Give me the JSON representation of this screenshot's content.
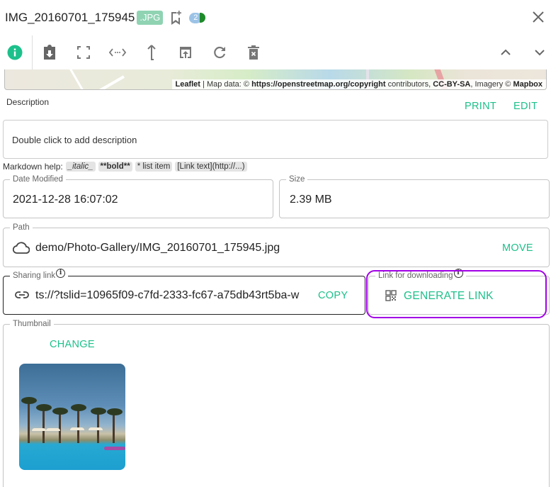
{
  "header": {
    "file_name": "IMG_20160701_175945",
    "extension": ".JPG",
    "badge_count": "2",
    "colors": {
      "extension_badge": "#8fd3b3",
      "count_badge": "#9cc3e6",
      "accent": "#1dc08b",
      "highlight": "#a100e6"
    }
  },
  "toolbar": {
    "buttons": [
      {
        "name": "info",
        "icon": "info-icon"
      },
      {
        "name": "download",
        "icon": "clipboard-download-icon"
      },
      {
        "name": "fullscreen",
        "icon": "fullscreen-icon"
      },
      {
        "name": "open-native",
        "icon": "code-arrows-icon"
      },
      {
        "name": "open-parent",
        "icon": "arrow-up-icon"
      },
      {
        "name": "open-in-new-window",
        "icon": "open-in-new-icon"
      },
      {
        "name": "reload",
        "icon": "refresh-icon"
      },
      {
        "name": "delete",
        "icon": "delete-icon"
      },
      {
        "name": "previous",
        "icon": "chevron-up-icon"
      },
      {
        "name": "next",
        "icon": "chevron-down-icon"
      }
    ]
  },
  "map": {
    "attribution": {
      "leaflet": "Leaflet",
      "sep": " | Map data: © ",
      "osm_link": "https://openstreetmap.org/copyright",
      "contributors": " contributors, ",
      "license": "CC-BY-SA",
      "imagery": ", Imagery © ",
      "provider": "Mapbox"
    }
  },
  "description": {
    "label": "Description",
    "print_label": "PRINT",
    "edit_label": "EDIT",
    "placeholder": "Double click to add description"
  },
  "markdown_help": {
    "label": "Markdown help:",
    "chips": [
      "_italic_",
      "**bold**",
      "* list item",
      "[Link text](http://...)"
    ]
  },
  "properties": {
    "date_modified": {
      "label": "Date Modified",
      "value": "2021-12-28 16:07:02"
    },
    "size": {
      "label": "Size",
      "value": "2.39 MB"
    },
    "path": {
      "label": "Path",
      "value": "demo/Photo-Gallery/IMG_20160701_175945.jpg",
      "action": "MOVE"
    },
    "sharing_link": {
      "label": "Sharing link",
      "value": "ts://?tslid=10965f09-c7fd-2333-fc67-a75db43rt5ba-w",
      "action": "COPY"
    },
    "download_link": {
      "label": "Link for downloading",
      "action": "GENERATE LINK"
    },
    "thumbnail": {
      "label": "Thumbnail",
      "action": "CHANGE"
    }
  }
}
